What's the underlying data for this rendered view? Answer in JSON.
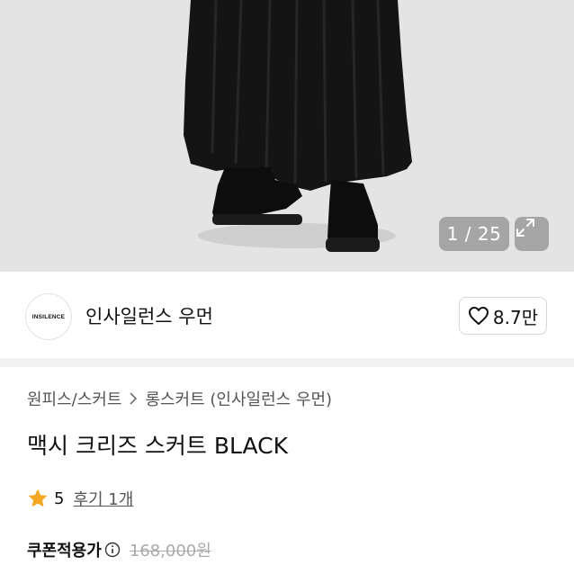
{
  "gallery": {
    "counter": "1 / 25"
  },
  "brand": {
    "logo_text": "INSILENCE",
    "name": "인사일런스 우먼",
    "likes": "8.7만"
  },
  "breadcrumb": {
    "category": "원피스/스커트",
    "subcategory": "롱스커트 (인사일런스 우먼)"
  },
  "product": {
    "title": "맥시 크리즈 스커트 BLACK",
    "rating": "5",
    "review_link": "후기 1개",
    "coupon_price_label": "쿠폰적용가",
    "original_price": "168,000원"
  },
  "colors": {
    "star": "#f5a623",
    "divider": "#f2f2f2"
  }
}
